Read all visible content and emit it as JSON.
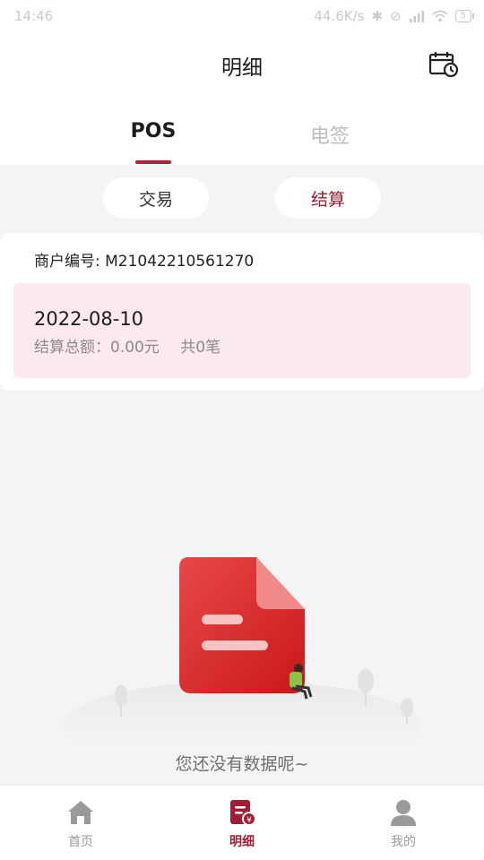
{
  "status_bar": {
    "time": "14:46",
    "net_speed": "44.6K/s",
    "battery": "5"
  },
  "header": {
    "title": "明细",
    "calendar_icon": "calendar-clock-icon"
  },
  "top_tabs": [
    {
      "label": "POS",
      "active": true
    },
    {
      "label": "电签",
      "active": false
    }
  ],
  "sub_tabs": [
    {
      "label": "交易",
      "active": false
    },
    {
      "label": "结算",
      "active": true
    }
  ],
  "merchant": {
    "label": "商户编号: M21042210561270"
  },
  "record": {
    "date": "2022-08-10",
    "total": "结算总额：0.00元",
    "count": "共0笔"
  },
  "empty_state": {
    "text": "您还没有数据呢~"
  },
  "bottom_nav": [
    {
      "label": "首页",
      "icon": "home-icon",
      "active": false
    },
    {
      "label": "明细",
      "icon": "detail-icon",
      "active": true
    },
    {
      "label": "我的",
      "icon": "user-icon",
      "active": false
    }
  ],
  "colors": {
    "accent": "#b4203b",
    "record_bg": "#fbe9ee",
    "page_bg": "#f4f4f4"
  }
}
